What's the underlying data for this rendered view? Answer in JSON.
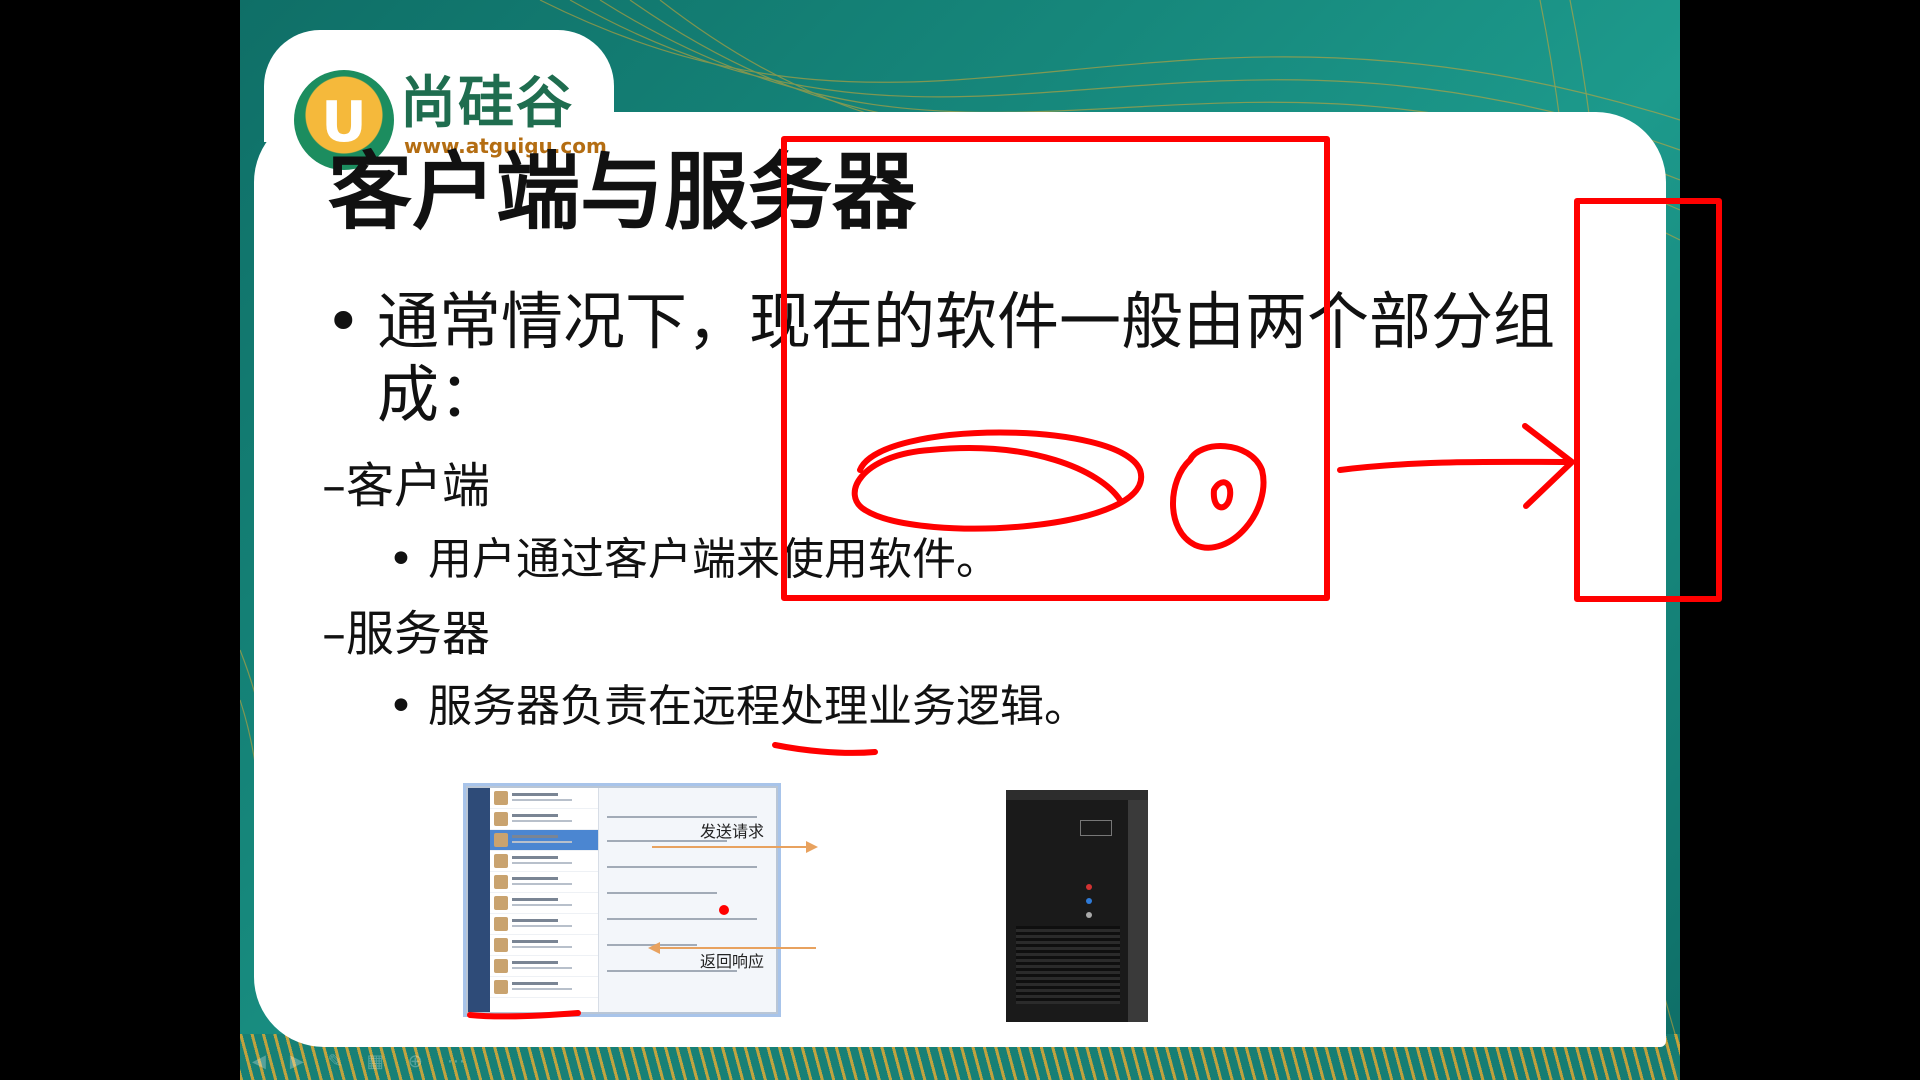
{
  "logo": {
    "mark": "U",
    "name": "尚硅谷",
    "url": "www.atguigu.com"
  },
  "slide": {
    "title": "客户端与服务器",
    "bullet_main": "通常情况下，现在的软件一般由两个部分组成：",
    "client_heading": "–客户端",
    "client_detail": "用户通过客户端来使用软件。",
    "server_heading": "–服务器",
    "server_detail": "服务器负责在远程处理业务逻辑。"
  },
  "diagram": {
    "request_label": "发送请求",
    "response_label": "返回响应",
    "arrow_color": "#e8a25f"
  },
  "colors": {
    "annotation": "#ff0000",
    "teal": "#16877b",
    "gold": "#d3a537"
  },
  "icons": {
    "nav": [
      "prev-icon",
      "next-icon",
      "pen-icon",
      "slides-icon",
      "zoom-icon",
      "more-icon"
    ]
  }
}
